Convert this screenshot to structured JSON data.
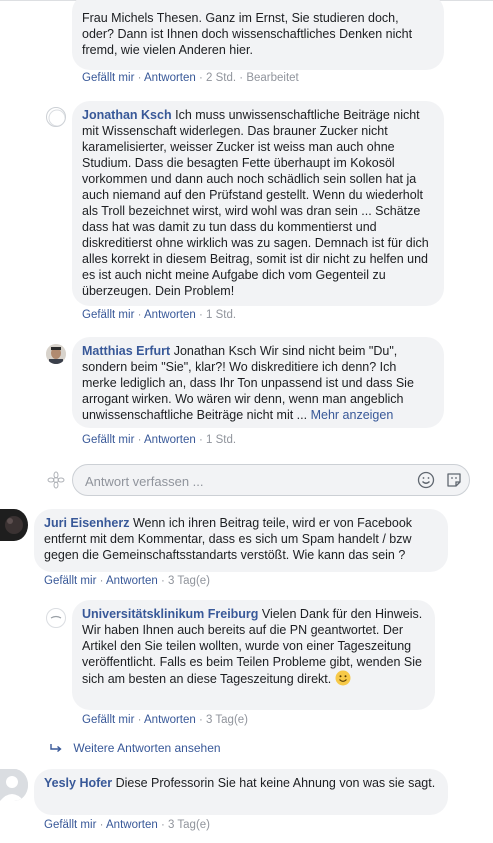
{
  "comments": [
    {
      "text_lines_partial": "Frau Michels Thesen. Ganz im Ernst, Sie studieren doch, oder? Dann ist Ihnen doch wissenschaftliches Denken nicht fremd, wie vielen Anderen hier.",
      "actions": {
        "like": "Gefällt mir",
        "reply": "Antworten",
        "time": "2 Std.",
        "edited": "Bearbeitet"
      }
    },
    {
      "author": "Jonathan Ksch",
      "text": "Ich muss unwissenschaftliche Beiträge nicht mit Wissenschaft widerlegen. Das brauner Zucker nicht karamelisierter, weisser Zucker ist weiss man auch ohne Studium. Dass die besagten Fette überhaupt im Kokosöl vorkommen und dann auch noch schädlich sein sollen hat ja auch niemand auf den Prüfstand gestellt. Wenn du wiederholt als Troll bezeichnet wirst, wird wohl was dran sein ... Schätze dass hat was damit zu tun dass du kommentierst und diskreditierst ohne wirklich was zu sagen. Demnach ist für dich alles korrekt in diesem Beitrag, somit ist dir nicht zu helfen und es ist auch nicht meine Aufgabe dich vom Gegenteil zu überzeugen. Dein Problem!",
      "actions": {
        "like": "Gefällt mir",
        "reply": "Antworten",
        "time": "1 Std."
      }
    },
    {
      "author": "Matthias Erfurt",
      "text": "Jonathan Ksch Wir sind nicht beim \"Du\", sondern beim \"Sie\", klar?! Wo diskreditiere ich denn? Ich merke lediglich an, dass Ihr Ton unpassend ist und dass Sie arrogant wirken. Wo wären wir denn, wenn man angeblich unwissenschaftliche Beiträge nicht mit ...",
      "more": "Mehr anzeigen",
      "actions": {
        "like": "Gefällt mir",
        "reply": "Antworten",
        "time": "1 Std."
      }
    },
    {
      "author": "Juri Eisenherz",
      "text": "Wenn ich ihren Beitrag teile, wird er von Facebook entfernt mit dem Kommentar, dass es sich um Spam handelt / bzw gegen die Gemeinschaftsstandarts verstößt. Wie kann das sein ?",
      "actions": {
        "like": "Gefällt mir",
        "reply": "Antworten",
        "time": "3 Tag(e)"
      }
    },
    {
      "author": "Universitätsklinikum Freiburg",
      "text": "Vielen Dank für den Hinweis. Wir haben Ihnen auch bereits auf die PN geantwortet. Der Artikel den Sie teilen wollten, wurde von einer Tageszeitung veröffentlicht. Falls es beim Teilen Probleme gibt, wenden Sie sich am besten an diese Tageszeitung direkt.",
      "emoji": "🙂",
      "actions": {
        "like": "Gefällt mir",
        "reply": "Antworten",
        "time": "3 Tag(e)"
      }
    },
    {
      "author": "Yesly Hofer",
      "text": "Diese Professorin Sie hat keine Ahnung von was sie sagt.",
      "actions": {
        "like": "Gefällt mir",
        "reply": "Antworten",
        "time": "3 Tag(e)"
      }
    }
  ],
  "reply_box": {
    "placeholder": "Antwort verfassen ..."
  },
  "more_replies": "Weitere Antworten ansehen",
  "separator": " · ",
  "icons": {
    "smiley": "smiley-icon",
    "sticker": "sticker-icon",
    "reply_arrow": "reply-arrow-icon"
  },
  "colors": {
    "link": "#385898",
    "bubble": "#f2f3f5",
    "muted": "#90949c"
  }
}
